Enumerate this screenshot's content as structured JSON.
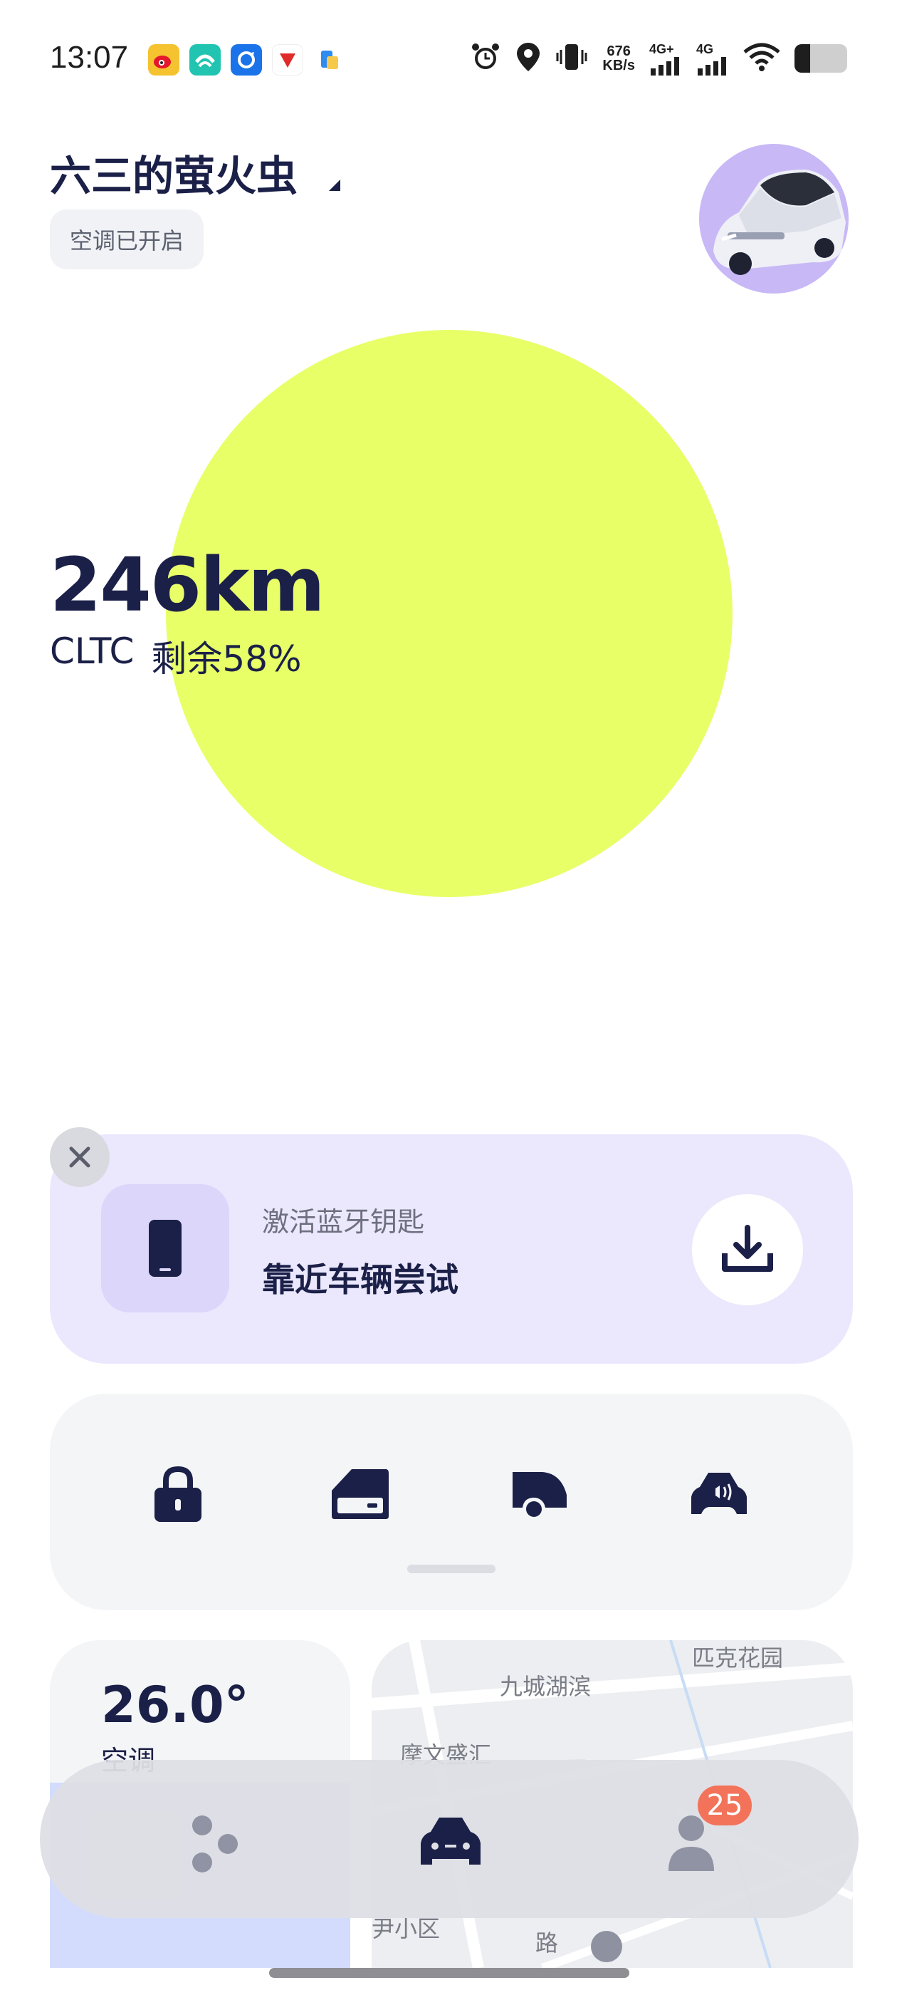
{
  "status_bar": {
    "time": "13:07",
    "app_icons": [
      "weibo-icon",
      "app-green-icon",
      "app-blue-icon",
      "app-red-icon",
      "files-icon"
    ],
    "net_speed_value": "676",
    "net_speed_unit": "KB/s",
    "sim1_label": "4G+",
    "sim2_label": "4G",
    "battery_level": 0.3
  },
  "header": {
    "car_name": "六三的萤火虫",
    "ac_status": "空调已开启"
  },
  "energy": {
    "range": "246km",
    "standard": "CLTC",
    "remaining": "剩余58%",
    "color": "#e8ff68"
  },
  "bluetooth_card": {
    "title": "激活蓝牙钥匙",
    "subtitle": "靠近车辆尝试"
  },
  "controls": [
    "lock-icon",
    "trunk-icon",
    "tailgate-icon",
    "horn-icon"
  ],
  "climate": {
    "temperature": "26.0°",
    "label": "空调"
  },
  "map": {
    "labels": [
      "九城湖滨",
      "匹克花园",
      "摩文盛汇",
      "路",
      "尹小区"
    ]
  },
  "bottom_nav": {
    "items": [
      "discover-icon",
      "car-icon",
      "profile-icon"
    ],
    "badge": "25"
  },
  "colors": {
    "primary": "#1b2048",
    "accent": "#e8ff68",
    "card_purple": "#ebe8fd",
    "badge": "#f2735a"
  }
}
